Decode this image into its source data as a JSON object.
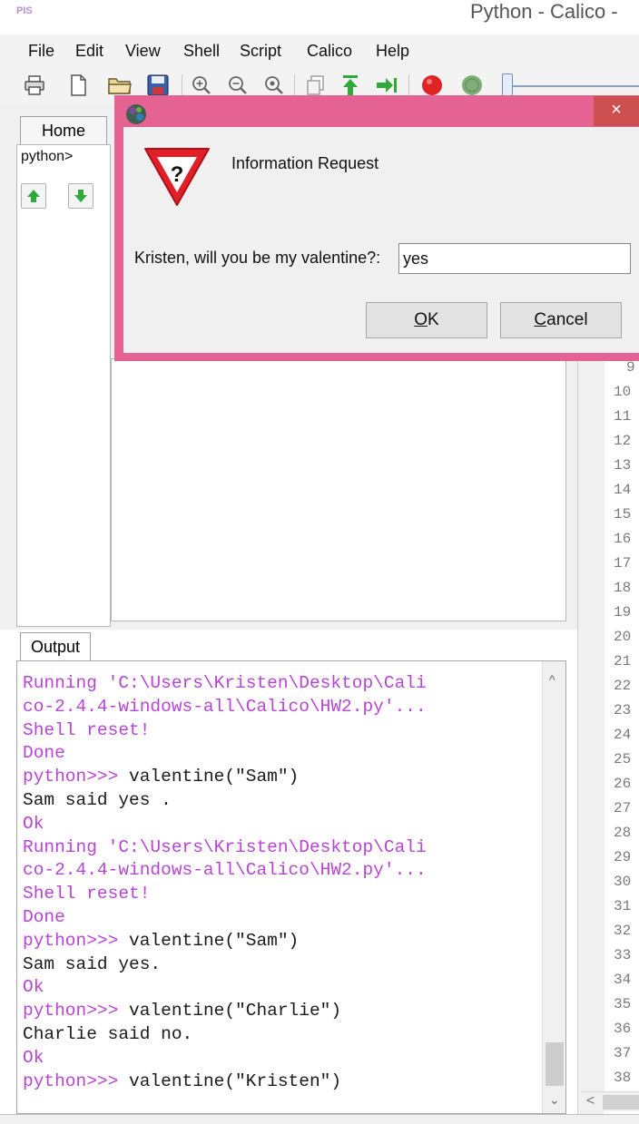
{
  "window": {
    "app_icon_text": "PIS",
    "title": "Python - Calico -"
  },
  "menu": [
    "File",
    "Edit",
    "View",
    "Shell",
    "Script",
    "Calico",
    "Help"
  ],
  "toolbar": {
    "icons": [
      "print-icon",
      "new-file-icon",
      "open-folder-icon",
      "save-icon",
      "zoom-in-icon",
      "zoom-out-icon",
      "zoom-reset-icon",
      "copy-icon",
      "run-icon",
      "step-icon",
      "stop-icon",
      "pause-icon",
      "speed-slider"
    ],
    "colors": {
      "stop": "#e02424",
      "pause": "#7fae7a",
      "run": "#2eaa3a"
    }
  },
  "left": {
    "home_tab": "Home",
    "prompt": "python>"
  },
  "output": {
    "tab": "Output",
    "lines": [
      {
        "text": "Running 'C:\\Users\\Kristen\\Desktop\\Cali",
        "kind": "sys"
      },
      {
        "text": "co-2.4.4-windows-all\\Calico\\HW2.py'...",
        "kind": "sys"
      },
      {
        "text": "Shell reset!",
        "kind": "sys"
      },
      {
        "text": "Done",
        "kind": "sys"
      },
      {
        "prompt": "python>>> ",
        "text": "valentine(\"Sam\")",
        "kind": "prompt"
      },
      {
        "text": "Sam said yes .",
        "kind": "user"
      },
      {
        "text": "Ok",
        "kind": "sys"
      },
      {
        "text": "Running 'C:\\Users\\Kristen\\Desktop\\Cali",
        "kind": "sys"
      },
      {
        "text": "co-2.4.4-windows-all\\Calico\\HW2.py'...",
        "kind": "sys"
      },
      {
        "text": "Shell reset!",
        "kind": "sys"
      },
      {
        "text": "Done",
        "kind": "sys"
      },
      {
        "prompt": "python>>> ",
        "text": "valentine(\"Sam\")",
        "kind": "prompt"
      },
      {
        "text": "Sam said yes.",
        "kind": "user"
      },
      {
        "text": "Ok",
        "kind": "sys"
      },
      {
        "prompt": "python>>> ",
        "text": "valentine(\"Charlie\")",
        "kind": "prompt"
      },
      {
        "text": "Charlie said no.",
        "kind": "user"
      },
      {
        "text": "Ok",
        "kind": "sys"
      },
      {
        "prompt": "python>>> ",
        "text": "valentine(\"Kristen\")",
        "kind": "prompt"
      }
    ],
    "colors": {
      "system": "#b844d6",
      "user": "#1a1a1a"
    }
  },
  "editor": {
    "line_numbers": [
      "9",
      "10",
      "11",
      "12",
      "13",
      "14",
      "15",
      "16",
      "17",
      "18",
      "19",
      "20",
      "21",
      "22",
      "23",
      "24",
      "25",
      "26",
      "27",
      "28",
      "29",
      "30",
      "31",
      "32",
      "33",
      "34",
      "35",
      "36",
      "37",
      "38"
    ]
  },
  "dialog": {
    "heading": "Information Request",
    "prompt": "Kristen, will you be my valentine?:",
    "input_value": "yes",
    "ok_label": "OK",
    "ok_access_key": "O",
    "ok_rest": "K",
    "cancel_label": "Cancel",
    "cancel_access_key": "C",
    "cancel_rest": "ancel",
    "close_glyph": "×",
    "frame_color": "#e46393"
  }
}
